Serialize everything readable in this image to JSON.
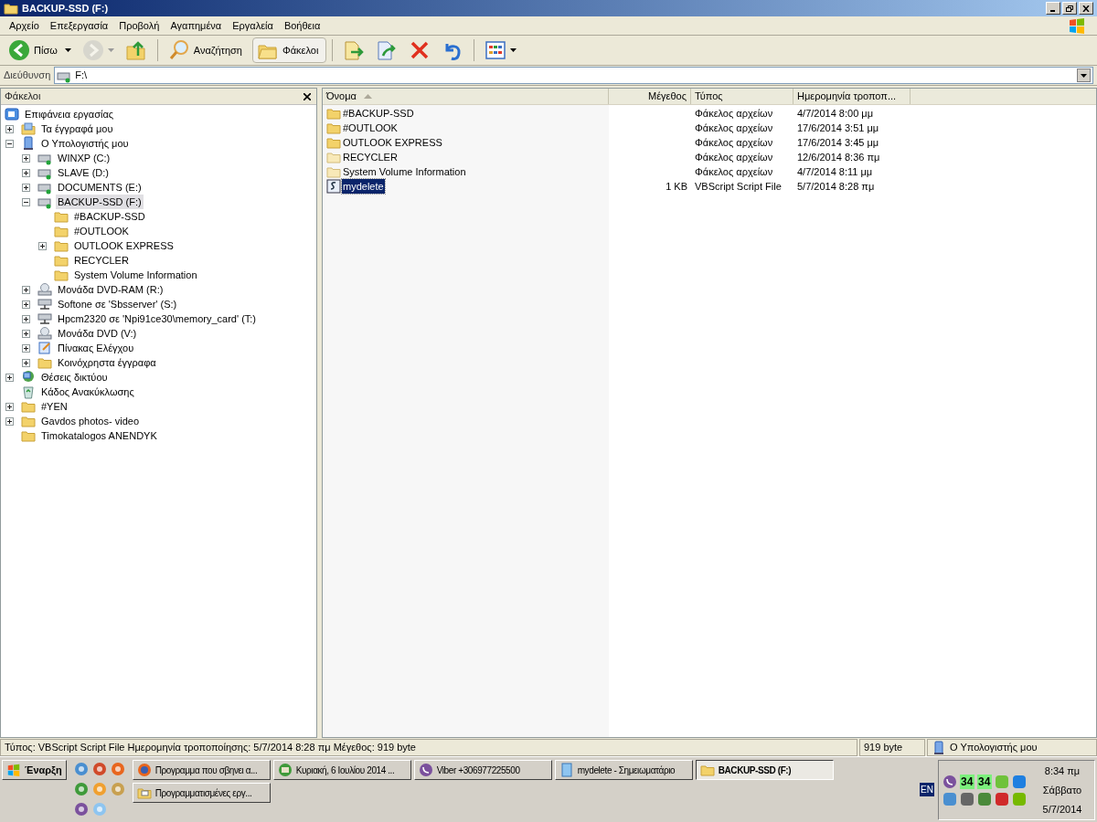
{
  "window": {
    "title": "BACKUP-SSD (F:)"
  },
  "menu": [
    "Αρχείο",
    "Επεξεργασία",
    "Προβολή",
    "Αγαπημένα",
    "Εργαλεία",
    "Βοήθεια"
  ],
  "toolbar": [
    {
      "kind": "back",
      "label": "Πίσω",
      "dropdown": true,
      "disabled": false,
      "pressed": false
    },
    {
      "kind": "forward",
      "dropdown": true,
      "disabled": true,
      "pressed": false
    },
    {
      "kind": "up",
      "disabled": false,
      "pressed": false
    },
    {
      "kind": "search",
      "label": "Αναζήτηση",
      "disabled": false,
      "pressed": false
    },
    {
      "kind": "folders",
      "label": "Φάκελοι",
      "disabled": false,
      "pressed": true
    },
    {
      "kind": "move",
      "disabled": false,
      "pressed": false
    },
    {
      "kind": "copy",
      "disabled": false,
      "pressed": false
    },
    {
      "kind": "delete",
      "disabled": false,
      "pressed": false
    },
    {
      "kind": "undo",
      "disabled": false,
      "pressed": false
    },
    {
      "kind": "views",
      "dropdown": true,
      "disabled": false,
      "pressed": false
    }
  ],
  "address": {
    "label": "Διεύθυνση",
    "value": "F:\\"
  },
  "folders_pane": {
    "title": "Φάκελοι",
    "tree": [
      {
        "label": "Επιφάνεια εργασίας",
        "kind": "desktop",
        "selected": false,
        "children": [
          {
            "label": "Τα έγγραφά μου",
            "kind": "docs",
            "expanded": false,
            "selected": false
          },
          {
            "label": "Ο Υπολογιστής μου",
            "kind": "computer",
            "expanded": true,
            "selected": false,
            "children": [
              {
                "label": "WINXP (C:)",
                "kind": "drive",
                "expanded": false,
                "selected": false
              },
              {
                "label": "SLAVE (D:)",
                "kind": "drive",
                "expanded": false,
                "selected": false
              },
              {
                "label": "DOCUMENTS (E:)",
                "kind": "drive",
                "expanded": false,
                "selected": false
              },
              {
                "label": "BACKUP-SSD (F:)",
                "kind": "drive",
                "expanded": true,
                "selected": true,
                "children": [
                  {
                    "label": "#BACKUP-SSD",
                    "kind": "folder",
                    "selected": false
                  },
                  {
                    "label": "#OUTLOOK",
                    "kind": "folder",
                    "selected": false
                  },
                  {
                    "label": "OUTLOOK EXPRESS",
                    "kind": "folder",
                    "expanded": false,
                    "selected": false
                  },
                  {
                    "label": "RECYCLER",
                    "kind": "folder",
                    "selected": false
                  },
                  {
                    "label": "System Volume Information",
                    "kind": "folder",
                    "selected": false
                  }
                ]
              },
              {
                "label": "Μονάδα DVD-RAM (R:)",
                "kind": "dvd",
                "expanded": false,
                "selected": false
              },
              {
                "label": "Softone σε 'Sbsserver' (S:)",
                "kind": "netdrive",
                "expanded": false,
                "selected": false
              },
              {
                "label": "Hpcm2320 σε 'Npi91ce30\\memory_card' (T:)",
                "kind": "netdrive",
                "expanded": false,
                "selected": false
              },
              {
                "label": "Μονάδα DVD (V:)",
                "kind": "dvd",
                "expanded": false,
                "selected": false
              },
              {
                "label": "Πίνακας Ελέγχου",
                "kind": "control",
                "expanded": false,
                "selected": false
              },
              {
                "label": "Κοινόχρηστα έγγραφα",
                "kind": "folder",
                "expanded": false,
                "selected": false
              }
            ]
          },
          {
            "label": "Θέσεις δικτύου",
            "kind": "network",
            "expanded": false,
            "selected": false
          },
          {
            "label": "Κάδος Ανακύκλωσης",
            "kind": "recycle",
            "selected": false
          },
          {
            "label": "#YEN",
            "kind": "folder",
            "expanded": false,
            "selected": false
          },
          {
            "label": "Gavdos photos- video",
            "kind": "folder",
            "expanded": false,
            "selected": false
          },
          {
            "label": "Timokatalogos ANENDYK",
            "kind": "folder",
            "selected": false
          }
        ]
      }
    ]
  },
  "file_list": {
    "columns": [
      {
        "label": "Όνομα",
        "sorted": true
      },
      {
        "label": "Μέγεθος",
        "sorted": false
      },
      {
        "label": "Τύπος",
        "sorted": false
      },
      {
        "label": "Ημερομηνία τροποπ...",
        "sorted": false
      }
    ],
    "rows": [
      {
        "name": "#BACKUP-SSD",
        "kind": "folder",
        "type": "Φάκελος αρχείων",
        "date": "4/7/2014 8:00 μμ",
        "selected": false
      },
      {
        "name": "#OUTLOOK",
        "kind": "folder",
        "type": "Φάκελος αρχείων",
        "date": "17/6/2014 3:51 μμ",
        "selected": false
      },
      {
        "name": "OUTLOOK EXPRESS",
        "kind": "folder",
        "type": "Φάκελος αρχείων",
        "date": "17/6/2014 3:45 μμ",
        "selected": false
      },
      {
        "name": "RECYCLER",
        "kind": "folder-light",
        "type": "Φάκελος αρχείων",
        "date": "12/6/2014 8:36 πμ",
        "selected": false
      },
      {
        "name": "System Volume Information",
        "kind": "folder-light",
        "type": "Φάκελος αρχείων",
        "date": "4/7/2014 8:11 μμ",
        "selected": false
      },
      {
        "name": "mydelete",
        "kind": "script",
        "size": "1 KB",
        "type": "VBScript Script File",
        "date": "5/7/2014 8:28 πμ",
        "selected": true
      }
    ]
  },
  "status_bar": [
    "Τύπος: VBScript Script File Ημερομηνία τροποποίησης: 5/7/2014 8:28 πμ Μέγεθος: 919 byte",
    "919 byte",
    "Ο Υπολογιστής μου"
  ],
  "taskbar": {
    "start": "Έναρξη",
    "tasks": [
      {
        "label": "Προγραμμα που σβηνει α...",
        "kind": "firefox",
        "selected": false
      },
      {
        "label": "Κυριακή, 6 Ιουλίου 2014 ...",
        "kind": "mail",
        "selected": false
      },
      {
        "label": "Viber +306977225500",
        "kind": "viber",
        "selected": false
      },
      {
        "label": "mydelete - Σημειωματάριο",
        "kind": "notepad",
        "selected": false
      },
      {
        "label": "BACKUP-SSD (F:)",
        "kind": "folder",
        "selected": true
      },
      {
        "label": "Προγραμματισμένες εργ...",
        "kind": "tasks",
        "selected": false
      }
    ],
    "language": "EN",
    "tray_counters": [
      "34",
      "34"
    ],
    "clock": [
      "8:34 πμ",
      "Σάββατο",
      "5/7/2014"
    ]
  }
}
